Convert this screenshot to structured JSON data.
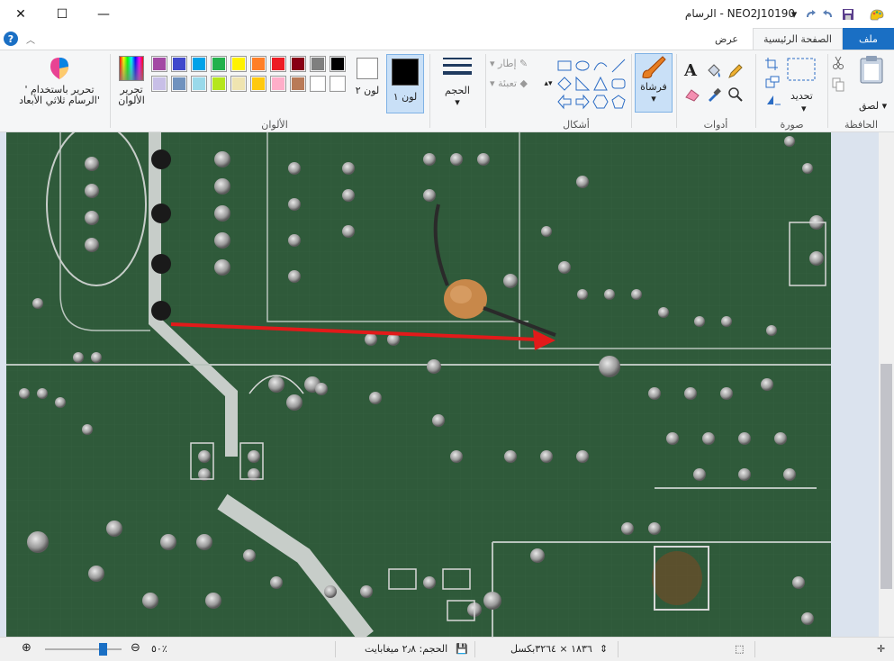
{
  "window": {
    "title": "NEO2J10190  - الرسام",
    "close": "✕",
    "maximize": "☐",
    "minimize": "—"
  },
  "tabs": {
    "file": "ملف",
    "home": "الصفحة الرئيسية",
    "view": "عرض"
  },
  "ribbon": {
    "clipboard": {
      "label": "الحافظة",
      "paste": "لصق"
    },
    "image": {
      "label": "صورة",
      "select": "تحديد"
    },
    "tools": {
      "label": "أدوات"
    },
    "brushes": {
      "label": "فرشاة"
    },
    "shapes": {
      "label": "أشكال",
      "outline": "إطار",
      "fill": "تعبئة"
    },
    "size": {
      "label": "الحجم"
    },
    "color1": {
      "label": "لون ١"
    },
    "color2": {
      "label": "لون ٢"
    },
    "colors": {
      "label": "الألوان"
    },
    "edit_colors": {
      "label": "تحرير الألوان"
    },
    "paint3d": {
      "label": "تحرير باستخدام ' الرسام ثلاثي الأبعاد'"
    }
  },
  "palette": {
    "row1": [
      "#000000",
      "#7f7f7f",
      "#880015",
      "#ed1c24",
      "#ff7f27",
      "#fff200",
      "#22b14c",
      "#00a2e8",
      "#3f48cc",
      "#a349a4"
    ],
    "row2": [
      "#ffffff",
      "#ffffff",
      "#b97a57",
      "#ffaec9",
      "#ffc90e",
      "#efe4b0",
      "#b5e61d",
      "#99d9ea",
      "#7092be",
      "#c8bfe7"
    ]
  },
  "colors_state": {
    "color1": "#000000",
    "color2": "#ffffff",
    "accent": "#1a6fc4"
  },
  "status": {
    "size": "الحجم: ٢٫٨ ميغابايت",
    "dimensions": "١٨٣٦ × ٣٢٦٤بكسل",
    "zoom": "٥٠٪"
  },
  "icons": {
    "paste": "clipboard-icon",
    "cut": "scissors-icon",
    "copy": "copy-icon",
    "select": "select-rect-icon",
    "crop": "crop-icon",
    "resize": "resize-icon",
    "rotate": "rotate-icon",
    "pencil": "pencil-icon",
    "fill": "bucket-icon",
    "text": "text-icon",
    "eraser": "eraser-icon",
    "picker": "eyedropper-icon",
    "magnifier": "magnifier-icon",
    "brush": "brush-icon"
  }
}
